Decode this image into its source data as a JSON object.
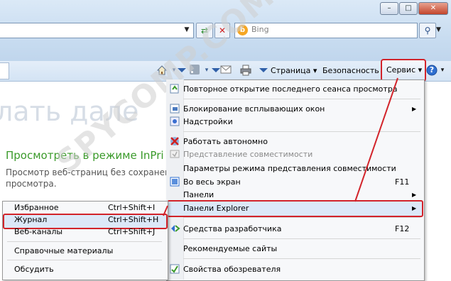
{
  "window": {
    "minimize_glyph": "–",
    "maximize_glyph": "□",
    "close_glyph": "✕"
  },
  "address": {
    "value": "",
    "dropdown_glyph": "▼",
    "refresh_glyph": "⇄",
    "stop_glyph": "✕"
  },
  "search": {
    "placeholder": "Bing",
    "engine_glyph": "b",
    "button_glyph": "⚲",
    "dropdown_glyph": "▼"
  },
  "command_bar": {
    "home_icon": "home-icon",
    "feeds_icon": "feeds-icon",
    "mail_icon": "mail-icon",
    "print_icon": "print-icon",
    "page_label": "Страница ▾",
    "safety_label": "Безопасность ▾",
    "tools_label": "Сервис ▾",
    "help_glyph": "?",
    "help_dropdown": "▾",
    "dropdown_glyph": "▾"
  },
  "page": {
    "big_text": "лать дале",
    "inprivate_heading": "Просмотреть в режиме InPri",
    "inprivate_desc": "Просмотр веб-страниц без сохранен просмотра."
  },
  "watermark": "SPYCOMP.COM",
  "tools_menu": {
    "items": [
      {
        "label": "Повторное открытие последнего сеанса просмотра",
        "shortcut": "",
        "icon": "reopen-icon"
      },
      {
        "label": "Блокирование всплывающих окон",
        "shortcut": "",
        "icon": "popup-blocker-icon",
        "submenu": true
      },
      {
        "label": "Надстройки",
        "shortcut": "",
        "icon": "addons-icon"
      },
      {
        "label": "Работать автономно",
        "shortcut": "",
        "icon": "offline-icon"
      },
      {
        "label": "Представление совместимости",
        "shortcut": "",
        "icon": "compat-icon",
        "disabled": true
      },
      {
        "label": "Параметры режима представления совместимости",
        "shortcut": ""
      },
      {
        "label": "Во весь экран",
        "shortcut": "F11",
        "icon": "fullscreen-icon"
      },
      {
        "label": "Панели",
        "shortcut": "",
        "submenu": true
      },
      {
        "label": "Панели Explorer",
        "shortcut": "",
        "submenu": true
      },
      {
        "label": "Средства разработчика",
        "shortcut": "F12",
        "icon": "devtools-icon"
      },
      {
        "label": "Рекомендуемые сайты",
        "shortcut": ""
      },
      {
        "label": "Свойства обозревателя",
        "shortcut": "",
        "icon": "options-icon"
      }
    ],
    "arrow_glyph": "▶"
  },
  "explorer_bars_submenu": {
    "items": [
      {
        "label": "Избранное",
        "shortcut": "Ctrl+Shift+I"
      },
      {
        "label": "Журнал",
        "shortcut": "Ctrl+Shift+H"
      },
      {
        "label": "Веб-каналы",
        "shortcut": "Ctrl+Shift+J"
      },
      {
        "label": "Справочные материалы",
        "shortcut": ""
      },
      {
        "label": "Обсудить",
        "shortcut": ""
      }
    ]
  },
  "colors": {
    "highlight_red": "#d2232a",
    "accent_green": "#3a9a2a"
  }
}
